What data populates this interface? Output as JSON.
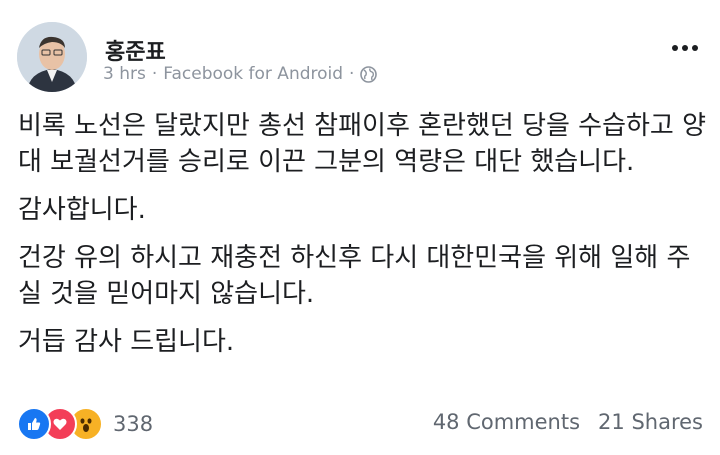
{
  "post": {
    "author": "홍준표",
    "time": "3 hrs",
    "separator": "·",
    "source": "Facebook for Android",
    "separator2": "·",
    "privacy_icon": "globe-icon",
    "menu_icon": "more-icon"
  },
  "content": {
    "paragraphs": [
      "비록 노선은 달랐지만 총선 참패이후 혼란했던 당을 수습하고 양대 보궐선거를 승리로 이끈 그분의 역량은 대단 했습니다.",
      "감사합니다.",
      "건강 유의 하시고 재충전 하신후 다시 대한민국을 위해 일해 주실 것을 믿어마지 않습니다.",
      "거듭 감사 드립니다."
    ]
  },
  "footer": {
    "reaction_icons": [
      "like-icon",
      "love-icon",
      "wow-icon"
    ],
    "reaction_count": "338",
    "comments": "48 Comments",
    "shares": "21 Shares"
  },
  "colors": {
    "like": "#1877f2",
    "love": "#f33e58",
    "wow": "#f7b125",
    "meta_text": "#8d949e"
  }
}
